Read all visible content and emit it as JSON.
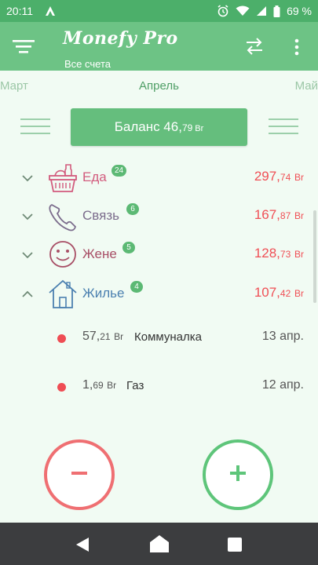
{
  "status_bar": {
    "time": "20:11",
    "battery": "69 %",
    "icons": [
      "app-notification-icon",
      "alarm-icon",
      "wifi-icon",
      "signal-icon",
      "battery-icon"
    ]
  },
  "app_bar": {
    "title": "Monefy Pro",
    "subtitle": "Все счета",
    "icons": [
      "menu-icon",
      "transfer-icon",
      "more-vert-icon"
    ]
  },
  "months": {
    "prev": "Март",
    "current": "Апрель",
    "next": "Май"
  },
  "balance": {
    "label": "Баланс 46,",
    "decimals": "79",
    "currency": "Br"
  },
  "categories": [
    {
      "name": "Еда",
      "count": "24",
      "amount_int": "297,",
      "amount_dec": "74",
      "currency": "Br",
      "color": "#d25b7d",
      "icon": "basket-icon",
      "expanded": false
    },
    {
      "name": "Связь",
      "count": "6",
      "amount_int": "167,",
      "amount_dec": "87",
      "currency": "Br",
      "color": "#7b6c8c",
      "icon": "phone-icon",
      "expanded": false
    },
    {
      "name": "Жене",
      "count": "5",
      "amount_int": "128,",
      "amount_dec": "73",
      "currency": "Br",
      "color": "#a84f66",
      "icon": "smile-icon",
      "expanded": false
    },
    {
      "name": "Жилье",
      "count": "4",
      "amount_int": "107,",
      "amount_dec": "42",
      "currency": "Br",
      "color": "#4b80b0",
      "icon": "house-icon",
      "expanded": true
    }
  ],
  "transactions": [
    {
      "amount_int": "57,",
      "amount_dec": "21",
      "currency": "Br",
      "name": "Коммуналка",
      "date": "13 апр."
    },
    {
      "amount_int": "1,",
      "amount_dec": "69",
      "currency": "Br",
      "name": "Газ",
      "date": "12 апр."
    }
  ],
  "colors": {
    "status_bar": "#4caf6a",
    "app_bar": "#6dc385",
    "expense_red": "#f04f55",
    "income_green": "#5ec57a",
    "background": "#f1fbf3"
  },
  "actions": {
    "expense_icon": "minus-icon",
    "income_icon": "plus-icon"
  },
  "nav": {
    "icons": [
      "back-icon",
      "home-icon",
      "recent-apps-icon"
    ]
  }
}
